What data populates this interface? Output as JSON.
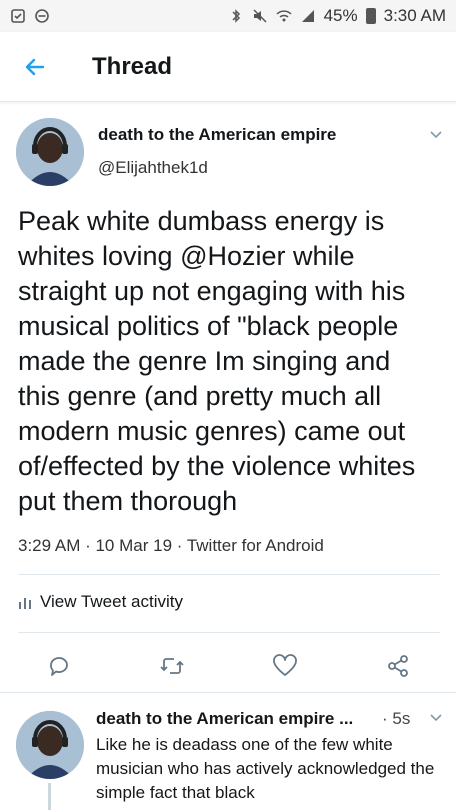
{
  "status_bar": {
    "battery": "45%",
    "time": "3:30 AM"
  },
  "header": {
    "title": "Thread"
  },
  "tweet": {
    "author_name": "death to the American empire",
    "author_handle": "@Elijahthek1d",
    "text": "Peak white dumbass energy is whites loving @Hozier while straight up not engaging with his musical politics of \"black people made the genre Im singing and this genre (and pretty much all modern music genres) came out of/effected by the violence whites put them thorough",
    "meta": "3:29 AM · 10 Mar 19 · Twitter for Android",
    "activity_label": "View Tweet activity"
  },
  "reply": {
    "author_name": "death to the American empire ...",
    "time": "· 5s",
    "text": "Like he is deadass one of the few white musician who has actively acknowledged the simple fact that black"
  },
  "colors": {
    "accent": "#1da1f2",
    "icon_gray": "#657786",
    "divider": "#e1e8ed"
  }
}
